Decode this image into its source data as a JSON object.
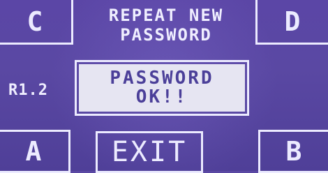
{
  "softkeys": {
    "top_left": "C",
    "top_right": "D",
    "bottom_left": "A",
    "bottom_center": "EXIT",
    "bottom_right": "B"
  },
  "title": {
    "line1": "REPEAT NEW",
    "line2": "PASSWORD"
  },
  "version": "R1.2",
  "status": {
    "line1": "PASSWORD",
    "line2": "OK!!"
  },
  "colors": {
    "background": "#5a48a3",
    "foreground": "#ecebff",
    "status_panel": "#e6e5f2",
    "status_text": "#4b3f99"
  }
}
